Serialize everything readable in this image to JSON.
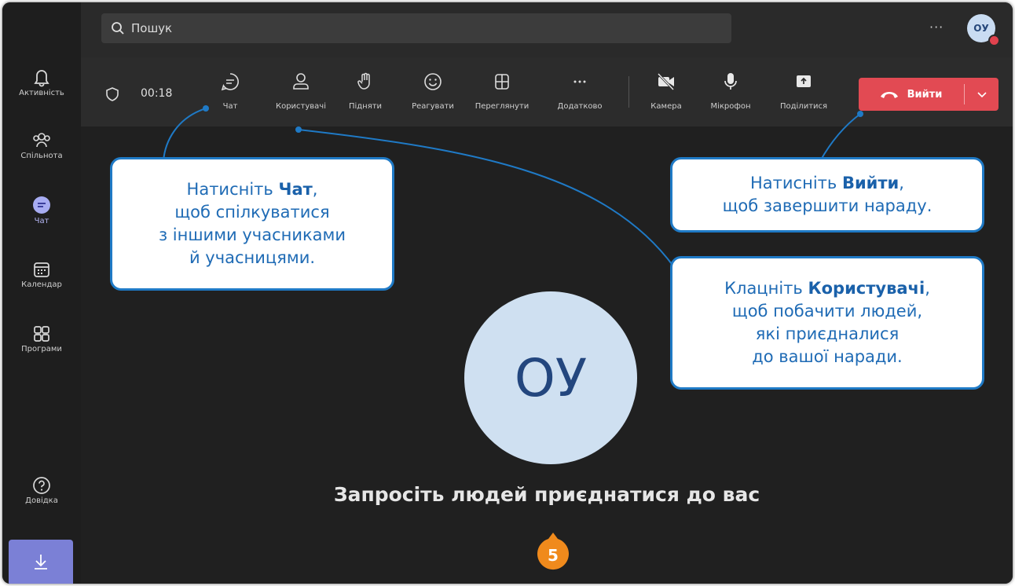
{
  "search": {
    "placeholder": "Пошук"
  },
  "top_more": "···",
  "user_initials": "ОУ",
  "rail": [
    {
      "label": "Активність",
      "icon": "bell-icon"
    },
    {
      "label": "Спільнота",
      "icon": "community-icon"
    },
    {
      "label": "Чат",
      "icon": "chat-icon",
      "active": true
    },
    {
      "label": "Календар",
      "icon": "calendar-icon"
    },
    {
      "label": "Програми",
      "icon": "apps-icon"
    },
    {
      "label": "Довідка",
      "icon": "help-icon"
    }
  ],
  "toolbar": {
    "timer": "00:18",
    "chat": "Чат",
    "people": "Користувачі",
    "raise": "Підняти",
    "react": "Реагувати",
    "view": "Переглянути",
    "more": "Додатково",
    "camera": "Камера",
    "mic": "Мікрофон",
    "share": "Поділитися",
    "leave": "Вийти"
  },
  "main": {
    "avatar_initials": "ОУ",
    "invite_text": "Запросіть людей приєднатися до вас",
    "step_number": "5"
  },
  "callouts": {
    "chat": {
      "pre": "Натисніть ",
      "bold": "Чат",
      "post": ",",
      "line2": "щоб спілкуватися",
      "line3": "з іншими учасниками",
      "line4": "й учасницями."
    },
    "leave": {
      "pre": "Натисніть ",
      "bold": "Вийти",
      "post": ",",
      "line2": "щоб завершити нараду."
    },
    "people": {
      "pre": "Клацніть ",
      "bold": "Користувачі",
      "post": ",",
      "line2": "щоб побачити людей,",
      "line3": "які приєдналися",
      "line4": "до вашої наради."
    }
  },
  "colors": {
    "leave_button": "#e24a53",
    "callout_border": "#1f7ac6",
    "badge": "#f08a1c",
    "rail_accent": "#7b80d6"
  }
}
